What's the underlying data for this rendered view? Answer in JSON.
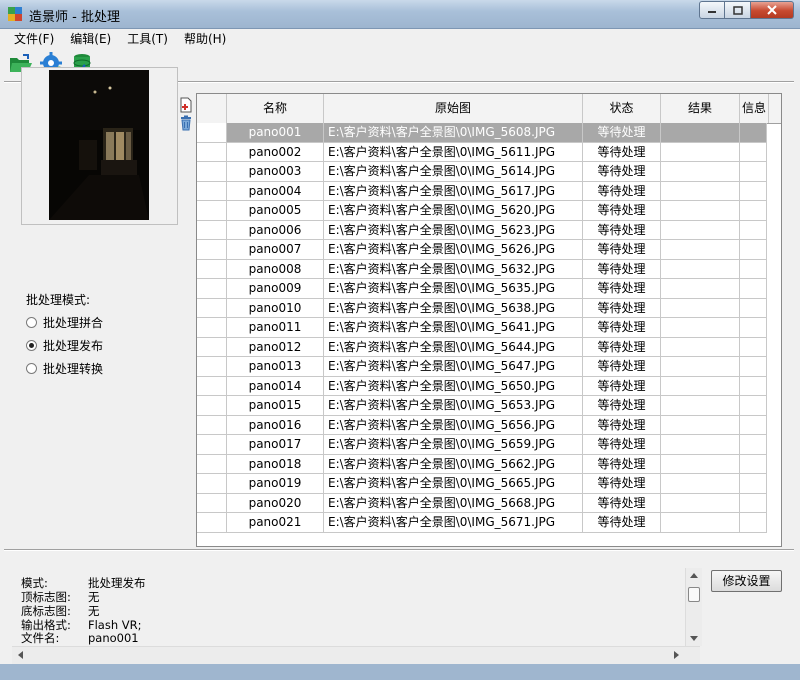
{
  "window": {
    "title": "造景师 - 批处理"
  },
  "menu": [
    "文件(F)",
    "编辑(E)",
    "工具(T)",
    "帮助(H)"
  ],
  "toolbar": {
    "icons": [
      "open-folder-icon",
      "settings-gear-icon",
      "database-sync-icon"
    ]
  },
  "side_icons": [
    "add-file-icon",
    "trash-icon"
  ],
  "mode": {
    "label": "批处理模式:",
    "options": [
      {
        "label": "批处理拼合",
        "checked": false
      },
      {
        "label": "批处理发布",
        "checked": true
      },
      {
        "label": "批处理转换",
        "checked": false
      }
    ]
  },
  "table": {
    "columns": [
      "",
      "名称",
      "原始图",
      "状态",
      "结果",
      "信息"
    ],
    "rows": [
      {
        "name": "pano001",
        "source": "E:\\客户资料\\客户全景图\\0\\IMG_5608.JPG",
        "status": "等待处理",
        "selected": true
      },
      {
        "name": "pano002",
        "source": "E:\\客户资料\\客户全景图\\0\\IMG_5611.JPG",
        "status": "等待处理"
      },
      {
        "name": "pano003",
        "source": "E:\\客户资料\\客户全景图\\0\\IMG_5614.JPG",
        "status": "等待处理"
      },
      {
        "name": "pano004",
        "source": "E:\\客户资料\\客户全景图\\0\\IMG_5617.JPG",
        "status": "等待处理"
      },
      {
        "name": "pano005",
        "source": "E:\\客户资料\\客户全景图\\0\\IMG_5620.JPG",
        "status": "等待处理"
      },
      {
        "name": "pano006",
        "source": "E:\\客户资料\\客户全景图\\0\\IMG_5623.JPG",
        "status": "等待处理"
      },
      {
        "name": "pano007",
        "source": "E:\\客户资料\\客户全景图\\0\\IMG_5626.JPG",
        "status": "等待处理"
      },
      {
        "name": "pano008",
        "source": "E:\\客户资料\\客户全景图\\0\\IMG_5632.JPG",
        "status": "等待处理"
      },
      {
        "name": "pano009",
        "source": "E:\\客户资料\\客户全景图\\0\\IMG_5635.JPG",
        "status": "等待处理"
      },
      {
        "name": "pano010",
        "source": "E:\\客户资料\\客户全景图\\0\\IMG_5638.JPG",
        "status": "等待处理"
      },
      {
        "name": "pano011",
        "source": "E:\\客户资料\\客户全景图\\0\\IMG_5641.JPG",
        "status": "等待处理"
      },
      {
        "name": "pano012",
        "source": "E:\\客户资料\\客户全景图\\0\\IMG_5644.JPG",
        "status": "等待处理"
      },
      {
        "name": "pano013",
        "source": "E:\\客户资料\\客户全景图\\0\\IMG_5647.JPG",
        "status": "等待处理"
      },
      {
        "name": "pano014",
        "source": "E:\\客户资料\\客户全景图\\0\\IMG_5650.JPG",
        "status": "等待处理"
      },
      {
        "name": "pano015",
        "source": "E:\\客户资料\\客户全景图\\0\\IMG_5653.JPG",
        "status": "等待处理"
      },
      {
        "name": "pano016",
        "source": "E:\\客户资料\\客户全景图\\0\\IMG_5656.JPG",
        "status": "等待处理"
      },
      {
        "name": "pano017",
        "source": "E:\\客户资料\\客户全景图\\0\\IMG_5659.JPG",
        "status": "等待处理"
      },
      {
        "name": "pano018",
        "source": "E:\\客户资料\\客户全景图\\0\\IMG_5662.JPG",
        "status": "等待处理"
      },
      {
        "name": "pano019",
        "source": "E:\\客户资料\\客户全景图\\0\\IMG_5665.JPG",
        "status": "等待处理"
      },
      {
        "name": "pano020",
        "source": "E:\\客户资料\\客户全景图\\0\\IMG_5668.JPG",
        "status": "等待处理"
      },
      {
        "name": "pano021",
        "source": "E:\\客户资料\\客户全景图\\0\\IMG_5671.JPG",
        "status": "等待处理"
      }
    ]
  },
  "info": {
    "rows": [
      {
        "key": "模式:",
        "value": "批处理发布"
      },
      {
        "key": "顶标志图:",
        "value": "无"
      },
      {
        "key": "底标志图:",
        "value": "无"
      },
      {
        "key": "输出格式:",
        "value": "Flash VR;"
      },
      {
        "key": "文件名:",
        "value": "pano001"
      }
    ]
  },
  "buttons": {
    "modify": "修改设置"
  },
  "colors": {
    "selected_row": "#a8a8a8",
    "title_bar": "#a9c0d9",
    "close_button": "#c7492f"
  }
}
